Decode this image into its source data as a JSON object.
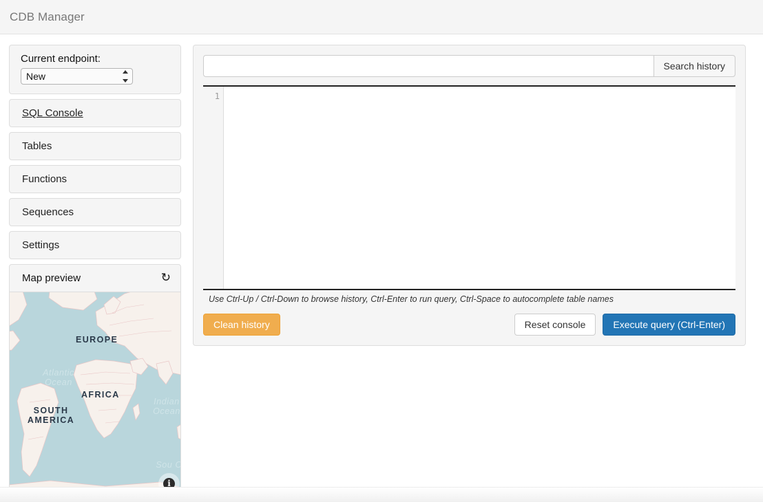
{
  "header": {
    "title": "CDB Manager"
  },
  "sidebar": {
    "endpoint": {
      "label": "Current endpoint:",
      "selected": "New",
      "options": [
        "New"
      ]
    },
    "items": [
      {
        "label": "SQL Console",
        "active": true
      },
      {
        "label": "Tables",
        "active": false
      },
      {
        "label": "Functions",
        "active": false
      },
      {
        "label": "Sequences",
        "active": false
      },
      {
        "label": "Settings",
        "active": false
      }
    ],
    "map_preview": {
      "title": "Map preview",
      "refresh_icon": "refresh-icon",
      "refresh_glyph": "↻",
      "info_glyph": "i",
      "labels": [
        "EUROPE",
        "AFRICA",
        "SOUTH AMERICA",
        "Atlantic Ocean",
        "Indian Ocean",
        "Sou Oc"
      ],
      "colors": {
        "ocean": "#b9d6dc",
        "land": "#f7f1ec",
        "border": "#e9c6c6",
        "label": "#2b3a4a",
        "ocean_label": "#cfe4e8"
      }
    }
  },
  "console": {
    "search": {
      "value": "",
      "placeholder": "",
      "button_label": "Search history"
    },
    "editor": {
      "line_number": "1",
      "code": "",
      "hint": "Use Ctrl-Up / Ctrl-Down to browse history, Ctrl-Enter to run query, Ctrl-Space to autocomplete table names"
    },
    "buttons": {
      "clean_history": "Clean history",
      "reset_console": "Reset console",
      "execute_query": "Execute query (Ctrl-Enter)"
    },
    "colors": {
      "warning": "#f0ad4e",
      "primary": "#2275b5",
      "default": "#ffffff"
    }
  }
}
